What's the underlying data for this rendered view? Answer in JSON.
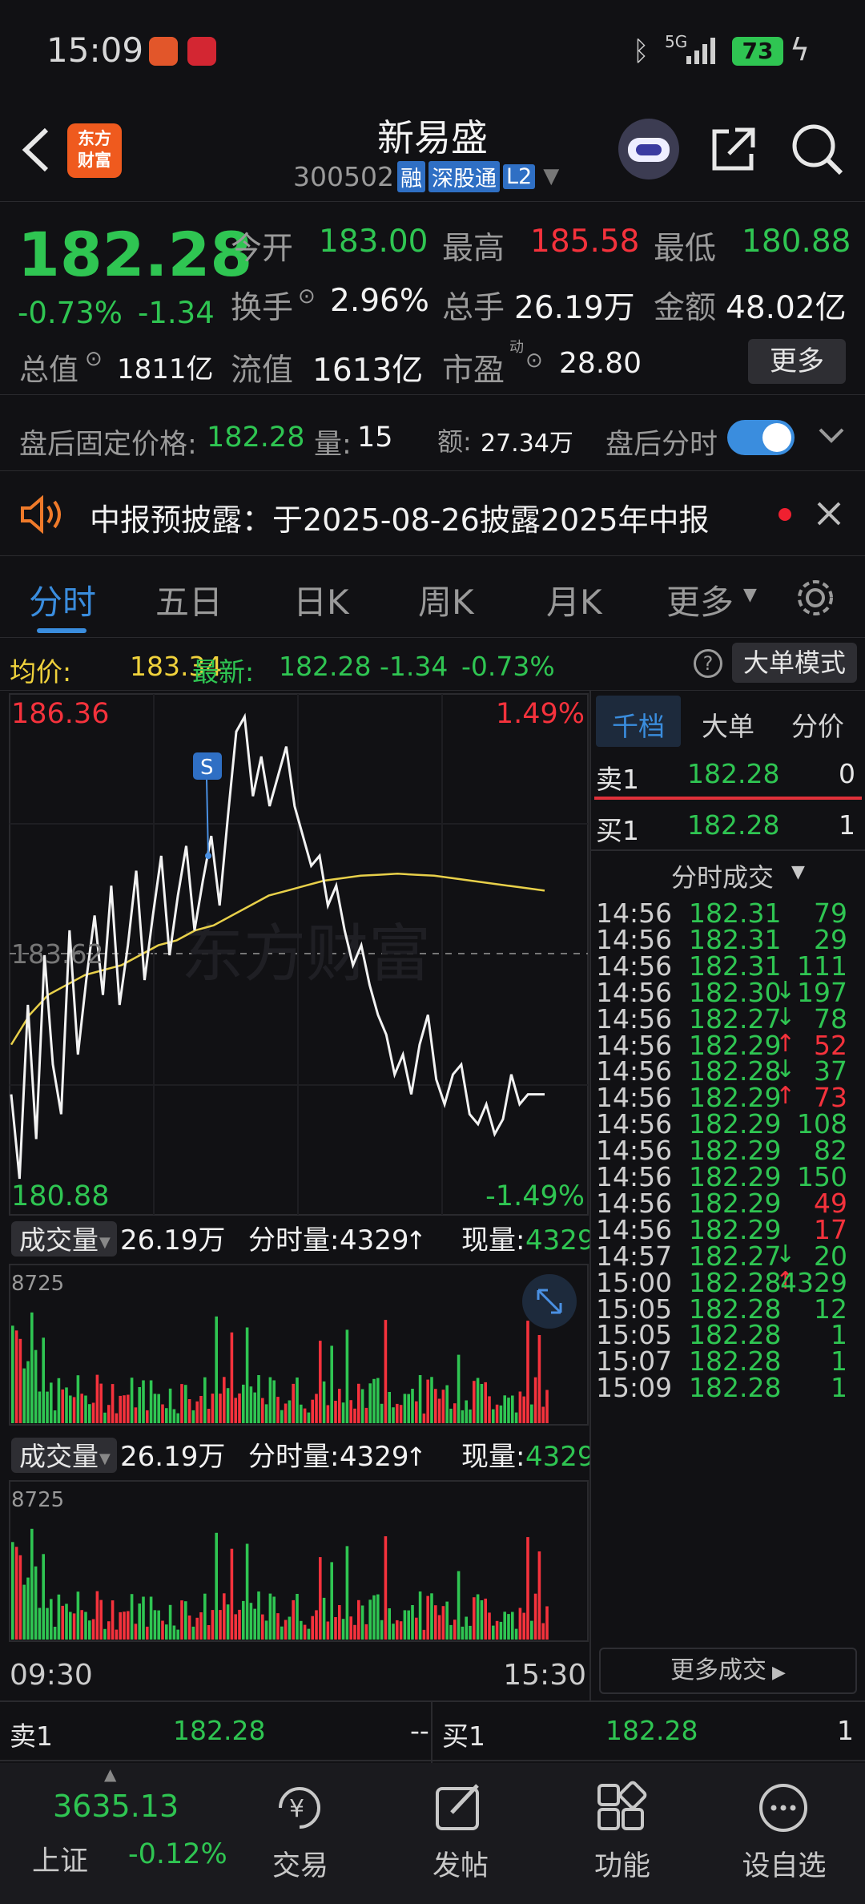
{
  "status_bar": {
    "time": "15:09",
    "battery": "73",
    "network": "5G"
  },
  "header": {
    "title": "新易盛",
    "code": "300502",
    "badges": [
      "融",
      "深股通",
      "L2"
    ],
    "app_logo": "东方\n财富"
  },
  "quote": {
    "price": "182.28",
    "change_pct": "-0.73%",
    "change_abs": "-1.34",
    "fields": [
      {
        "label": "今开",
        "value": "183.00"
      },
      {
        "label": "最高",
        "value": "185.58"
      },
      {
        "label": "最低",
        "value": "180.88"
      },
      {
        "label": "换手",
        "value": "2.96%"
      },
      {
        "label": "总手",
        "value": "26.19万"
      },
      {
        "label": "金额",
        "value": "48.02亿"
      },
      {
        "label": "总值",
        "value": "1811亿"
      },
      {
        "label": "流值",
        "value": "1613亿"
      },
      {
        "label": "市盈",
        "value": "28.80",
        "sup": "动"
      }
    ],
    "more_button": "更多"
  },
  "after_hours": {
    "price_label": "盘后固定价格:",
    "price": "182.28",
    "vol_label": "量:",
    "vol": "15",
    "amt_label": "额:",
    "amt": "27.34万",
    "toggle_label": "盘后分时",
    "toggle_on": true
  },
  "notice": {
    "text": "中报预披露：于2025-08-26披露2025年中报"
  },
  "tabs": [
    "分时",
    "五日",
    "日K",
    "周K",
    "月K",
    "更多"
  ],
  "info_line": {
    "avg_label": "均价:",
    "avg": "183.34",
    "latest_label": "最新:",
    "latest": "182.28",
    "chg": "-1.34",
    "pct": "-0.73%",
    "mode_button": "大单模式"
  },
  "chart": {
    "y_top_price": "186.36",
    "y_top_pct": "1.49%",
    "y_mid": "183.62",
    "y_bottom_price": "180.88",
    "y_bottom_pct": "-1.49%",
    "time_start": "09:30",
    "time_end": "15:30",
    "marker": "S",
    "watermark": "东方财富"
  },
  "volume_panels": [
    {
      "label": "成交量",
      "total": "26.19万",
      "tick_label": "分时量:",
      "tick": "4329",
      "now_label": "现量:",
      "now": "4329",
      "max": "8725"
    },
    {
      "label": "成交量",
      "total": "26.19万",
      "tick_label": "分时量:",
      "tick": "4329",
      "now_label": "现量:",
      "now": "4329",
      "max": "8725"
    }
  ],
  "orderbook": {
    "tabs": [
      "千档",
      "大单",
      "分价"
    ],
    "sell1": {
      "label": "卖1",
      "price": "182.28",
      "vol": "0"
    },
    "buy1": {
      "label": "买1",
      "price": "182.28",
      "vol": "1"
    },
    "ticks_title": "分时成交",
    "ticks": [
      {
        "time": "14:56",
        "price": "182.31",
        "arrow": "",
        "vol": "79",
        "color": "green"
      },
      {
        "time": "14:56",
        "price": "182.31",
        "arrow": "",
        "vol": "29",
        "color": "green"
      },
      {
        "time": "14:56",
        "price": "182.31",
        "arrow": "",
        "vol": "111",
        "color": "green"
      },
      {
        "time": "14:56",
        "price": "182.30",
        "arrow": "↓",
        "vol": "197",
        "color": "green"
      },
      {
        "time": "14:56",
        "price": "182.27",
        "arrow": "↓",
        "vol": "78",
        "color": "green"
      },
      {
        "time": "14:56",
        "price": "182.29",
        "arrow": "↑",
        "vol": "52",
        "color": "red"
      },
      {
        "time": "14:56",
        "price": "182.28",
        "arrow": "↓",
        "vol": "37",
        "color": "green"
      },
      {
        "time": "14:56",
        "price": "182.29",
        "arrow": "↑",
        "vol": "73",
        "color": "red"
      },
      {
        "time": "14:56",
        "price": "182.29",
        "arrow": "",
        "vol": "108",
        "color": "green"
      },
      {
        "time": "14:56",
        "price": "182.29",
        "arrow": "",
        "vol": "82",
        "color": "green"
      },
      {
        "time": "14:56",
        "price": "182.29",
        "arrow": "",
        "vol": "150",
        "color": "green"
      },
      {
        "time": "14:56",
        "price": "182.29",
        "arrow": "",
        "vol": "49",
        "color": "red"
      },
      {
        "time": "14:56",
        "price": "182.29",
        "arrow": "",
        "vol": "17",
        "color": "red"
      },
      {
        "time": "14:57",
        "price": "182.27",
        "arrow": "↓",
        "vol": "20",
        "color": "green"
      },
      {
        "time": "15:00",
        "price": "182.28",
        "arrow": "↑",
        "vol": "4329",
        "color": "green"
      },
      {
        "time": "15:05",
        "price": "182.28",
        "arrow": "",
        "vol": "12",
        "color": "green"
      },
      {
        "time": "15:05",
        "price": "182.28",
        "arrow": "",
        "vol": "1",
        "color": "green"
      },
      {
        "time": "15:07",
        "price": "182.28",
        "arrow": "",
        "vol": "1",
        "color": "green"
      },
      {
        "time": "15:09",
        "price": "182.28",
        "arrow": "",
        "vol": "1",
        "color": "green"
      }
    ],
    "more_ticks": "更多成交"
  },
  "bottom_quote": {
    "sell_label": "卖1",
    "sell_price": "182.28",
    "sell_vol": "--",
    "buy_label": "买1",
    "buy_price": "182.28",
    "buy_vol": "1"
  },
  "bottom_nav": {
    "index_value": "3635.13",
    "index_name": "上证",
    "index_pct": "-0.12%",
    "items": [
      "交易",
      "发帖",
      "功能",
      "设自选"
    ]
  },
  "colors": {
    "up": "#f5323c",
    "down": "#2fc552",
    "avg_line": "#e8d04a",
    "accent": "#3a8dde"
  }
}
